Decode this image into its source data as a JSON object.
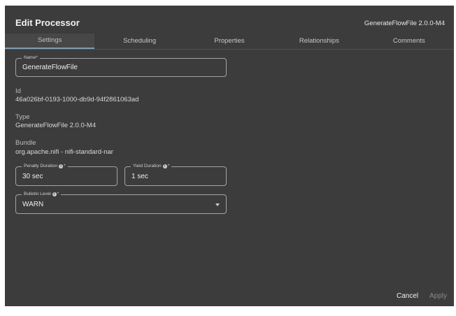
{
  "dialog": {
    "title": "Edit Processor",
    "subtitle": "GenerateFlowFile 2.0.0-M4"
  },
  "tabs": [
    {
      "label": "Settings",
      "active": true
    },
    {
      "label": "Scheduling",
      "active": false
    },
    {
      "label": "Properties",
      "active": false
    },
    {
      "label": "Relationships",
      "active": false
    },
    {
      "label": "Comments",
      "active": false
    }
  ],
  "settings": {
    "name": {
      "label": "Name*",
      "value": "GenerateFlowFile"
    },
    "id": {
      "label": "Id",
      "value": "46a026bf-0193-1000-db9d-94f2861063ad"
    },
    "type": {
      "label": "Type",
      "value": "GenerateFlowFile 2.0.0-M4"
    },
    "bundle": {
      "label": "Bundle",
      "value": "org.apache.nifi - nifi-standard-nar"
    },
    "penalty_duration": {
      "label": "Penalty Duration",
      "required": "*",
      "value": "30 sec"
    },
    "yield_duration": {
      "label": "Yield Duration",
      "required": "*",
      "value": "1 sec"
    },
    "bulletin_level": {
      "label": "Bulletin Level",
      "required": "*",
      "value": "WARN"
    }
  },
  "icons": {
    "info": "info-icon",
    "dropdown": "chevron-down-icon"
  },
  "actions": {
    "cancel": "Cancel",
    "apply": "Apply"
  },
  "colors": {
    "background": "#3c3c3c",
    "tab_indicator": "#7f9cb0"
  }
}
